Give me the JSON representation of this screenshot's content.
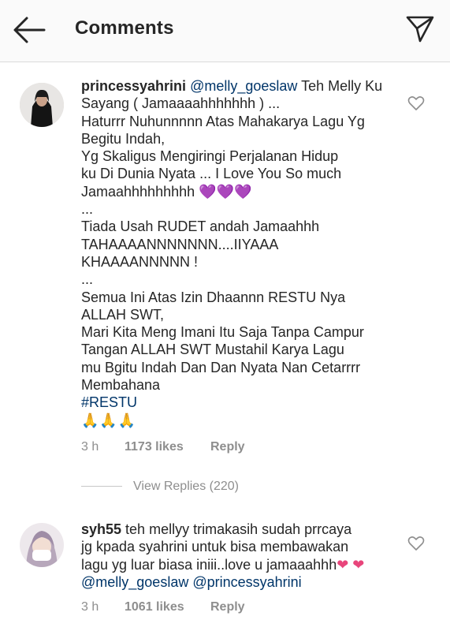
{
  "header": {
    "title": "Comments"
  },
  "comments": [
    {
      "username": "princessyahrini",
      "lines": [
        {
          "mention": "@melly_goeslaw",
          "text": " Teh Melly Ku"
        },
        {
          "text": "Sayang ( Jamaaaahhhhhhh ) ..."
        },
        {
          "text": "Haturrr Nuhunnnnn Atas Mahakarya Lagu Yg"
        },
        {
          "text": "Begitu Indah,"
        },
        {
          "text": "Yg Skaligus Mengiringi Perjalanan Hidup"
        },
        {
          "text": "ku Di Dunia Nyata ... I Love You So much"
        },
        {
          "text": "Jamaahhhhhhhhh",
          "emoji": "💜💜💜"
        },
        {
          "text": "..."
        },
        {
          "text": "Tiada Usah RUDET andah Jamaahhh"
        },
        {
          "text": "TAHAAAANNNNNNN....IIYAAA"
        },
        {
          "text": "KHAAAANNNNN !"
        },
        {
          "text": "..."
        },
        {
          "text": "Semua Ini Atas Izin Dhaannn RESTU Nya"
        },
        {
          "text": "ALLAH SWT,"
        },
        {
          "text": "Mari Kita Meng Imani Itu Saja Tanpa Campur"
        },
        {
          "text": "Tangan ALLAH SWT Mustahil Karya Lagu"
        },
        {
          "text": "mu Bgitu Indah Dan Dan Nyata Nan Cetarrrr"
        },
        {
          "text": "Membahana"
        },
        {
          "tag": "#RESTU"
        },
        {
          "hands": "🙏🙏🙏"
        }
      ],
      "time": "3 h",
      "likes": "1173 likes",
      "reply": "Reply"
    },
    {
      "username": "syh55",
      "lines": [
        {
          "text": " teh mellyy trimakasih sudah prrcaya"
        },
        {
          "text": "jg kpada syahrini untuk bisa membawakan"
        },
        {
          "text": "lagu yg luar biasa iniii..love u jamaaahhh",
          "emoji": "❤ ❤"
        },
        {
          "mention": "@melly_goeslaw",
          "mention2": "@princessyahrini"
        }
      ],
      "time": "3 h",
      "likes": "1061 likes",
      "reply": "Reply"
    }
  ],
  "view_replies": "View Replies (220)",
  "icons": {
    "back": "arrow-left-icon",
    "send": "send-paper-plane-icon",
    "like": "heart-outline-icon"
  },
  "colors": {
    "text": "#262626",
    "muted": "#8e8e8e",
    "mention": "#003569",
    "purple_heart": "#8a3fd4",
    "pink_heart": "#e8457b"
  }
}
